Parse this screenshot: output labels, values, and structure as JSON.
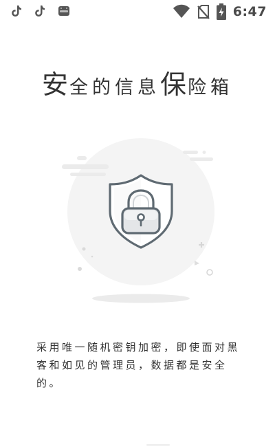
{
  "status_bar": {
    "time": "6:47",
    "notification_icons": [
      "tiktok-icon",
      "tiktok-icon",
      "android-app-icon"
    ],
    "system_icons": [
      "wifi-icon",
      "no-sim-icon",
      "battery-charging-icon"
    ]
  },
  "title": {
    "char1": "安",
    "part2": "全的信息",
    "char3": "保",
    "part4": "险箱"
  },
  "illustration": {
    "icon": "shield-lock-icon",
    "colors": {
      "circle": "#f4f4f4",
      "shield_stroke": "#5f6a72",
      "lock_fill": "#e4e6e8",
      "shadow": "#ebebeb"
    }
  },
  "description": {
    "text": "采用唯一随机密钥加密，即使面对黑客和如见的管理员，数据都是安全的。"
  }
}
